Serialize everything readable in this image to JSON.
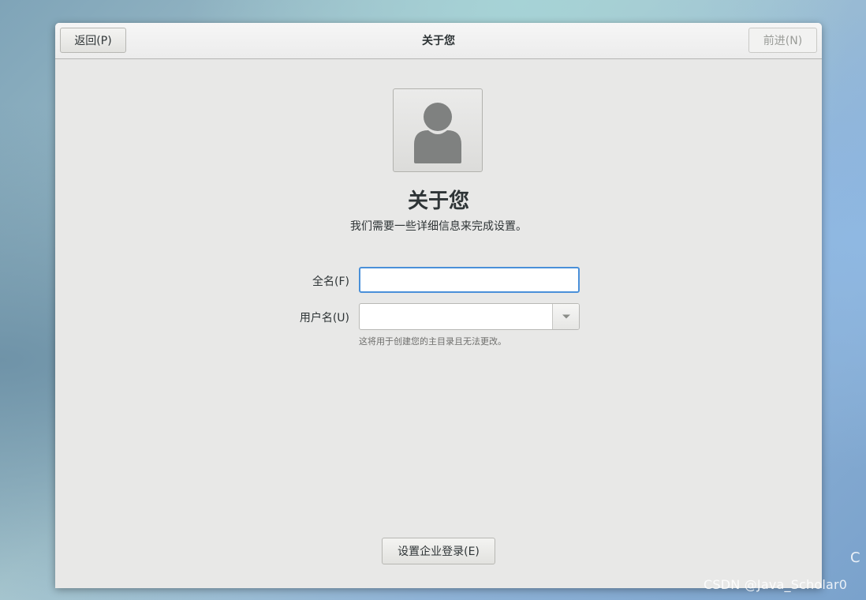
{
  "header": {
    "title": "关于您",
    "back_label": "返回(P)",
    "next_label": "前进(N)"
  },
  "main": {
    "heading": "关于您",
    "subtitle": "我们需要一些详细信息来完成设置。",
    "avatar_icon": "user-avatar-icon",
    "fullname": {
      "label": "全名(F)",
      "value": ""
    },
    "username": {
      "label": "用户名(U)",
      "value": "",
      "dropdown_icon": "chevron-down-icon"
    },
    "hint": "这将用于创建您的主目录且无法更改。",
    "enterprise_login_label": "设置企业登录(E)"
  },
  "desktop": {
    "watermark": "CSDN @Java_Scholar0",
    "edge_glyph": "C"
  },
  "colors": {
    "focus_border": "#4a90d9",
    "window_bg": "#e8e8e7",
    "text": "#2e3436"
  }
}
